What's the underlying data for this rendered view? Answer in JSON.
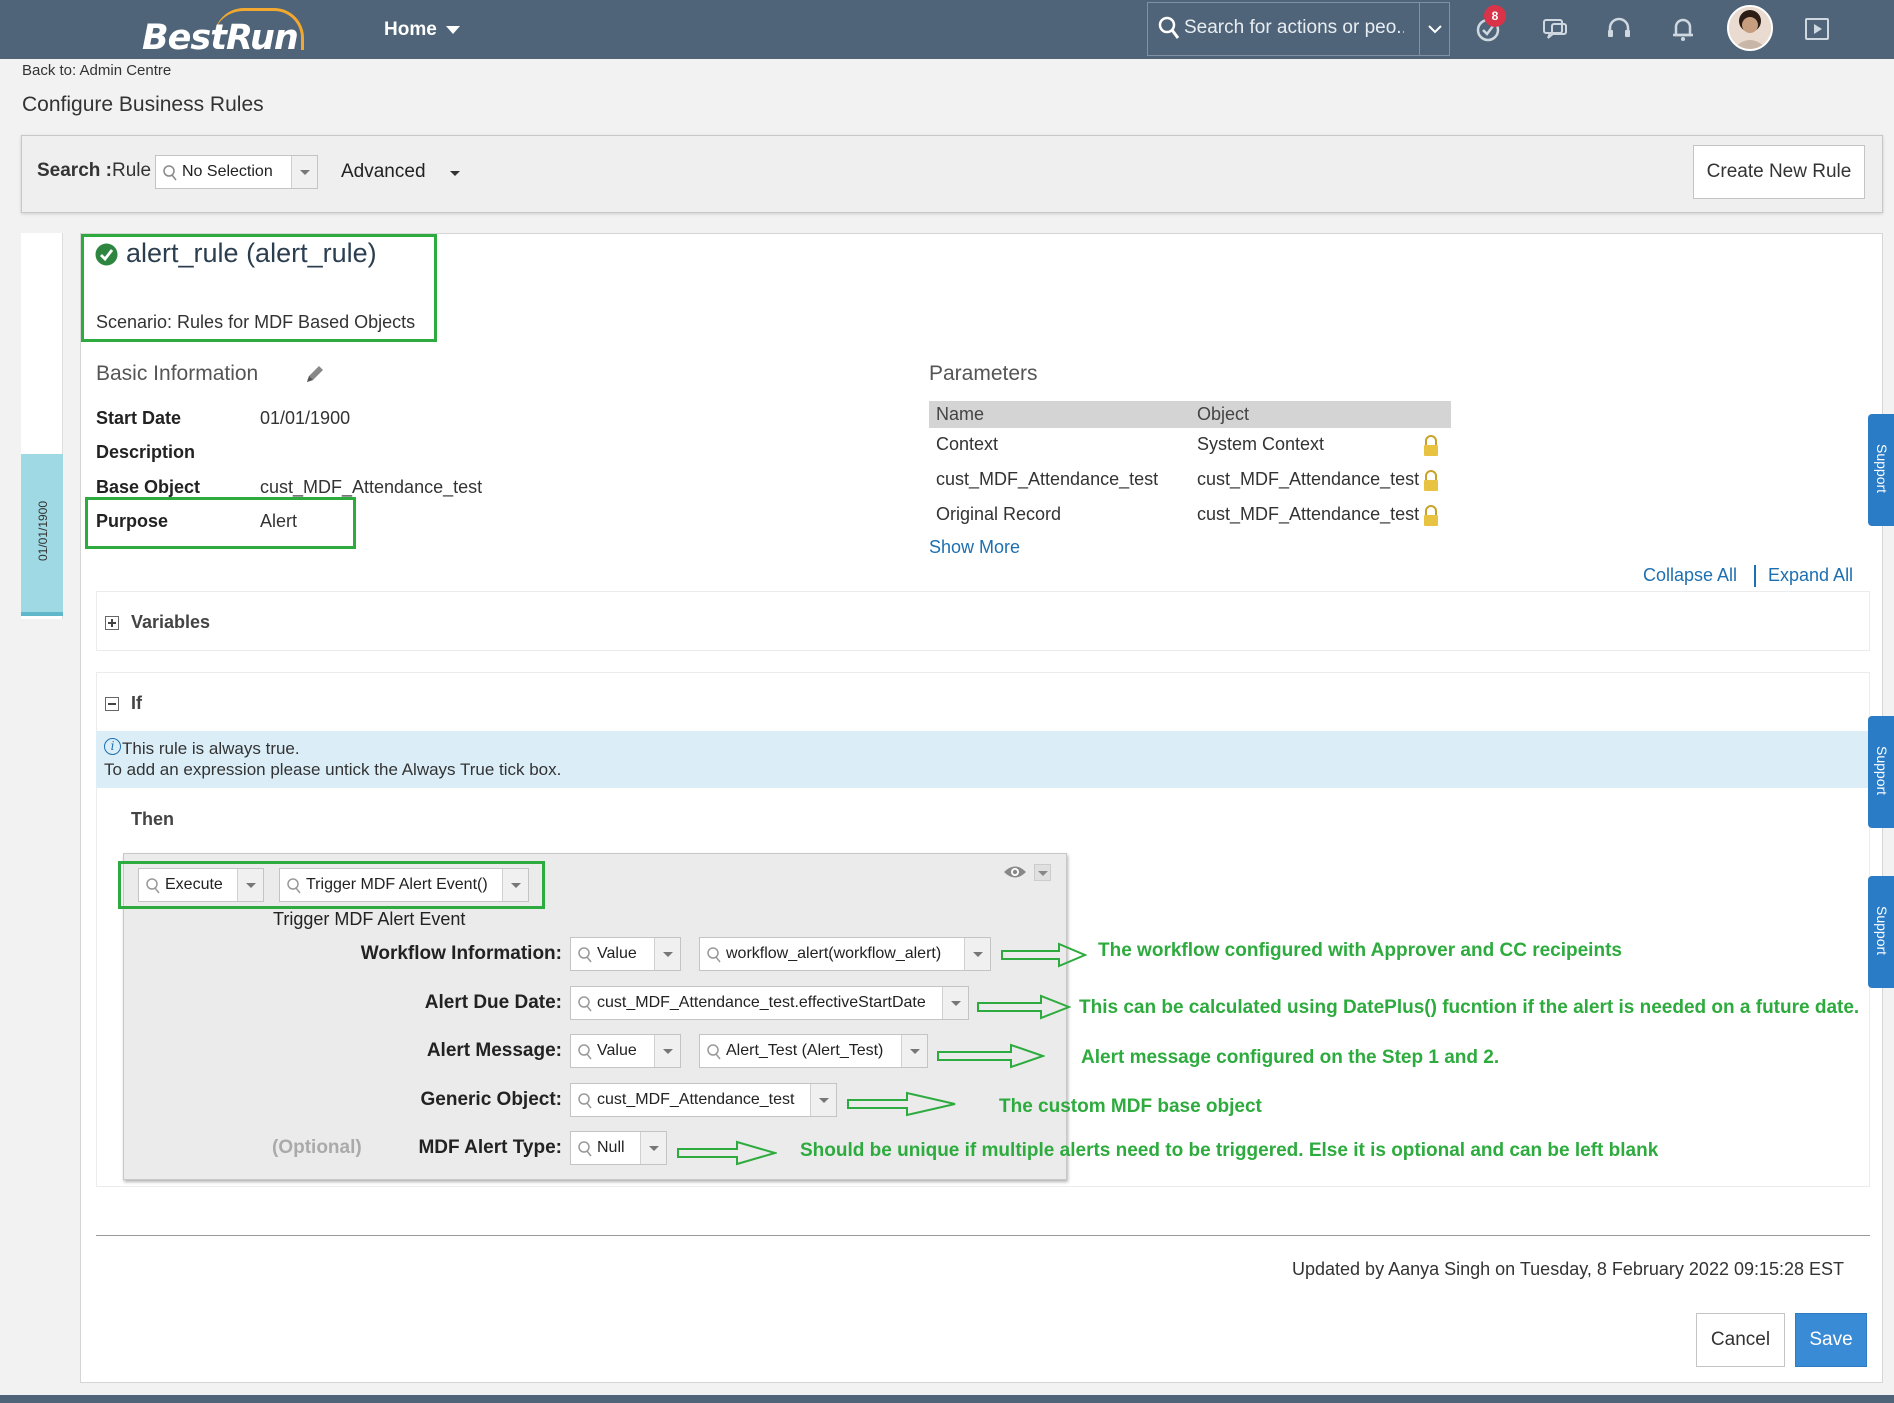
{
  "topbar": {
    "logo": "BestRun",
    "home_label": "Home",
    "search_placeholder": "Search for actions or peo...",
    "notification_count": "8"
  },
  "header": {
    "back_link": "Back to: Admin Centre",
    "page_title": "Configure Business Rules"
  },
  "search_panel": {
    "search_label": "Search :",
    "rule_label": "Rule",
    "rule_value": "No Selection",
    "advanced_label": "Advanced",
    "create_button": "Create New Rule"
  },
  "timeline": {
    "date_label": "01/01/1900"
  },
  "rule": {
    "title": "alert_rule (alert_rule)",
    "scenario": "Scenario: Rules for MDF Based Objects"
  },
  "basic_info": {
    "heading": "Basic Information",
    "fields": [
      {
        "label": "Start Date",
        "value": "01/01/1900"
      },
      {
        "label": "Description",
        "value": ""
      },
      {
        "label": "Base Object",
        "value": "cust_MDF_Attendance_test"
      },
      {
        "label": "Purpose",
        "value": "Alert"
      }
    ]
  },
  "parameters": {
    "heading": "Parameters",
    "columns": [
      "Name",
      "Object"
    ],
    "rows": [
      {
        "name": "Context",
        "object": "System Context"
      },
      {
        "name": "cust_MDF_Attendance_test",
        "object": "cust_MDF_Attendance_test"
      },
      {
        "name": "Original Record",
        "object": "cust_MDF_Attendance_test"
      }
    ],
    "show_more": "Show More"
  },
  "controls": {
    "collapse_all": "Collapse All",
    "expand_all": "Expand All"
  },
  "variables": {
    "label": "Variables"
  },
  "if_block": {
    "label": "If",
    "info_line1": "This rule is always true.",
    "info_line2": "To add an expression please untick the Always True tick box."
  },
  "then_block": {
    "label": "Then",
    "action_type": "Execute",
    "action_function": "Trigger MDF Alert Event()",
    "action_title": "Trigger MDF Alert Event",
    "workflow_label": "Workflow Information:",
    "workflow_type": "Value",
    "workflow_value": "workflow_alert(workflow_alert)",
    "due_date_label": "Alert Due Date:",
    "due_date_value": "cust_MDF_Attendance_test.effectiveStartDate",
    "message_label": "Alert Message:",
    "message_type": "Value",
    "message_value": "Alert_Test (Alert_Test)",
    "generic_label": "Generic Object:",
    "generic_value": "cust_MDF_Attendance_test",
    "optional_label": "(Optional)",
    "alert_type_label": "MDF Alert Type:",
    "alert_type_value": "Null"
  },
  "annotations": {
    "workflow": "The workflow configured with Approver and CC recipeints",
    "due_date": "This can be calculated using DatePlus() fucntion if the alert is needed on a future date.",
    "message": "Alert message configured on the Step 1 and 2.",
    "generic": "The custom MDF base object",
    "alert_type": "Should be unique if multiple alerts need to be triggered. Else it is optional and can be left blank"
  },
  "support_tab": "Support",
  "footer": {
    "updated": "Updated by Aanya Singh on Tuesday, 8 February 2022 09:15:28 EST",
    "cancel": "Cancel",
    "save": "Save"
  },
  "colors": {
    "topbar": "#4f6478",
    "annotation_green": "#2eab3e",
    "link_blue": "#1d6fb0",
    "save_blue": "#3a8bd6"
  }
}
